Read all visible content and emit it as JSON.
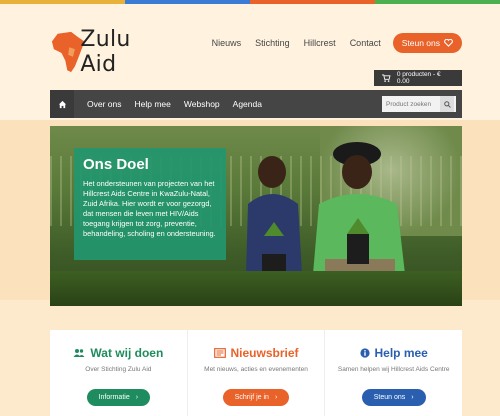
{
  "colors": {
    "accent_orange": "#e8622a",
    "green": "#1e8c5e",
    "blue": "#2a5fb0",
    "nav_dark": "#454545",
    "stripe_colors": [
      "#e8b23a",
      "#3a7bd5",
      "#e8622a",
      "#4caf50"
    ]
  },
  "header": {
    "logo_text": "Zulu Aid",
    "logo_icon": "africa-map-icon",
    "nav": [
      "Nieuws",
      "Stichting",
      "Hillcrest",
      "Contact"
    ],
    "donate_label": "Steun ons",
    "donate_icon": "heart-icon",
    "cart_icon": "cart-icon",
    "cart_label": "0 producten - € 0.00"
  },
  "navbar": {
    "home_icon": "home-icon",
    "items": [
      "Over ons",
      "Help mee",
      "Webshop",
      "Agenda"
    ],
    "search_placeholder": "Product zoeken",
    "search_icon": "search-icon"
  },
  "hero": {
    "title": "Ons Doel",
    "text": "Het ondersteunen van projecten van het Hillcrest Aids Centre in KwaZulu-Natal, Zuid Afrika. Hier wordt er voor gezorgd, dat mensen die leven met HIV/Aids toegang krijgen tot zorg, preventie, behandeling, scholing en ondersteuning."
  },
  "cards": [
    {
      "icon": "users-icon",
      "title": "Wat wij doen",
      "subtitle": "Over Stichting Zulu Aid",
      "button": "Informatie",
      "color": "#1e8c5e"
    },
    {
      "icon": "newspaper-icon",
      "title": "Nieuwsbrief",
      "subtitle": "Met nieuws, acties en evenementen",
      "button": "Schrijf je in",
      "color": "#e8622a"
    },
    {
      "icon": "info-icon",
      "title": "Help mee",
      "subtitle": "Samen helpen wij Hillcrest Aids Centre",
      "button": "Steun ons",
      "color": "#2a5fb0"
    }
  ]
}
